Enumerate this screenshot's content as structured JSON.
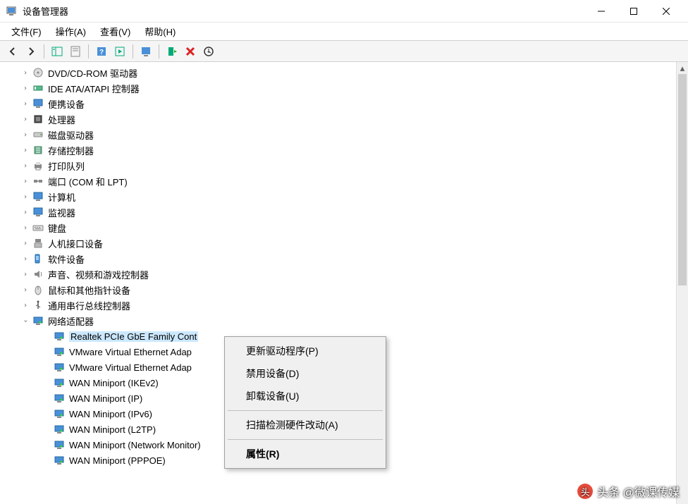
{
  "window": {
    "title": "设备管理器"
  },
  "menu": {
    "file": "文件(F)",
    "action": "操作(A)",
    "view": "查看(V)",
    "help": "帮助(H)"
  },
  "tree": {
    "items": [
      {
        "label": "DVD/CD-ROM 驱动器",
        "icon": "disc"
      },
      {
        "label": "IDE ATA/ATAPI 控制器",
        "icon": "ide"
      },
      {
        "label": "便携设备",
        "icon": "monitor"
      },
      {
        "label": "处理器",
        "icon": "cpu"
      },
      {
        "label": "磁盘驱动器",
        "icon": "disk"
      },
      {
        "label": "存储控制器",
        "icon": "storage"
      },
      {
        "label": "打印队列",
        "icon": "printer"
      },
      {
        "label": "端口 (COM 和 LPT)",
        "icon": "port"
      },
      {
        "label": "计算机",
        "icon": "monitor"
      },
      {
        "label": "监视器",
        "icon": "monitor"
      },
      {
        "label": "键盘",
        "icon": "keyboard"
      },
      {
        "label": "人机接口设备",
        "icon": "hid"
      },
      {
        "label": "软件设备",
        "icon": "software"
      },
      {
        "label": "声音、视频和游戏控制器",
        "icon": "audio"
      },
      {
        "label": "鼠标和其他指针设备",
        "icon": "mouse"
      },
      {
        "label": "通用串行总线控制器",
        "icon": "usb"
      }
    ],
    "network": {
      "label": "网络适配器",
      "children": [
        {
          "label": "Realtek PCIe GbE Family Cont",
          "selected": true
        },
        {
          "label": "VMware Virtual Ethernet Adap"
        },
        {
          "label": "VMware Virtual Ethernet Adap"
        },
        {
          "label": "WAN Miniport (IKEv2)"
        },
        {
          "label": "WAN Miniport (IP)"
        },
        {
          "label": "WAN Miniport (IPv6)"
        },
        {
          "label": "WAN Miniport (L2TP)"
        },
        {
          "label": "WAN Miniport (Network Monitor)"
        },
        {
          "label": "WAN Miniport (PPPOE)"
        }
      ]
    }
  },
  "context_menu": {
    "update": "更新驱动程序(P)",
    "disable": "禁用设备(D)",
    "uninstall": "卸载设备(U)",
    "scan": "扫描检测硬件改动(A)",
    "properties": "属性(R)"
  },
  "watermark": "头条 @微课传媒"
}
